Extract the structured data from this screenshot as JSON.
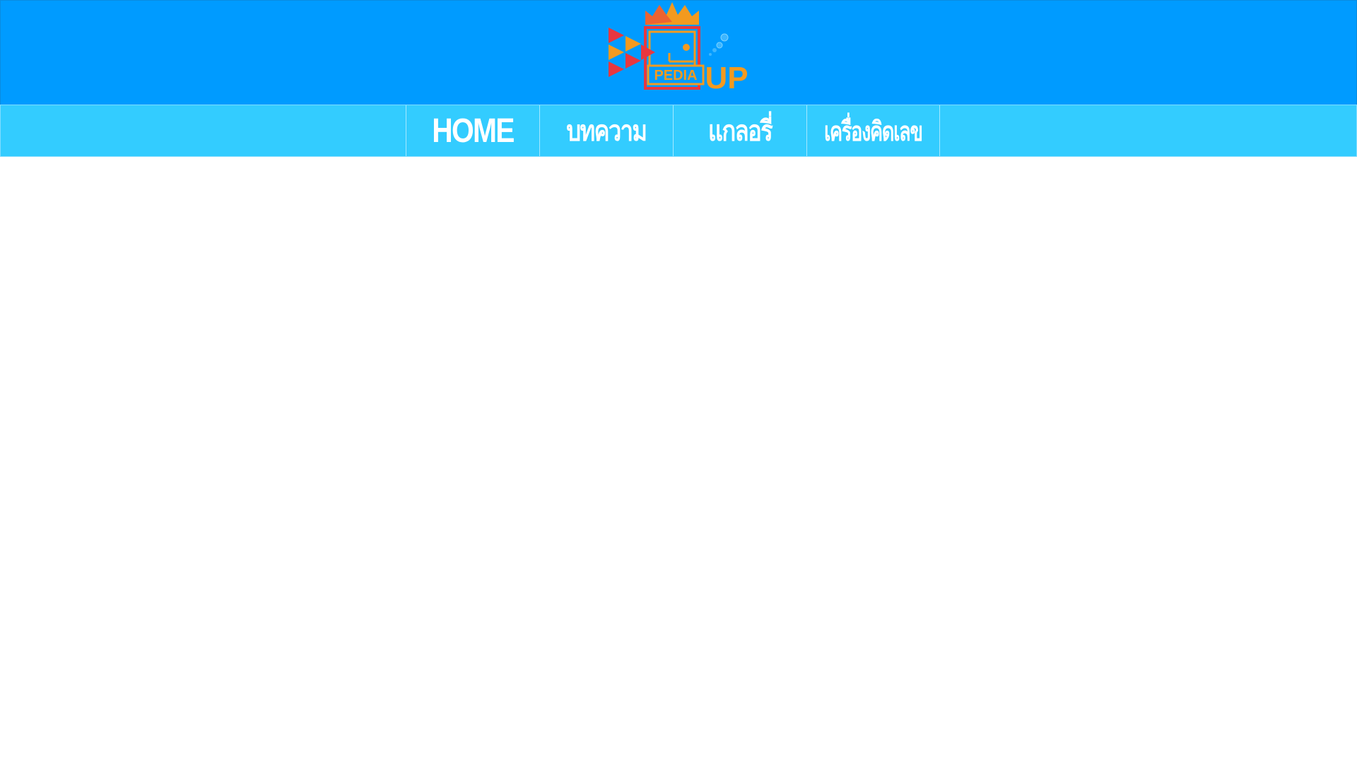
{
  "header": {
    "logo": {
      "text_pedia": "PEDIA",
      "text_up": "UP",
      "colors": {
        "red": "#e8373f",
        "orange": "#f39a1f",
        "bubble": "#3db6ff"
      }
    },
    "background": "#009bff"
  },
  "nav": {
    "background": "#33ccff",
    "items": [
      {
        "label": "HOME"
      },
      {
        "label": "บทความ"
      },
      {
        "label": "แกลอรี่"
      },
      {
        "label": "เครื่องคิดเลข"
      }
    ]
  }
}
